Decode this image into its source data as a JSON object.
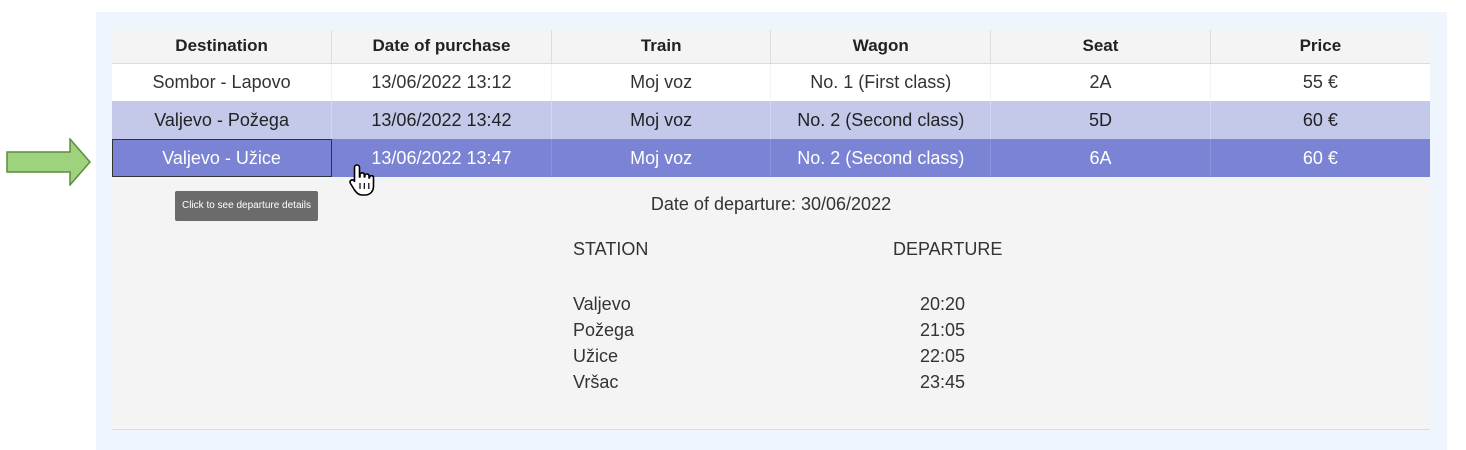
{
  "table": {
    "columns": [
      "Destination",
      "Date of purchase",
      "Train",
      "Wagon",
      "Seat",
      "Price"
    ],
    "rows": [
      [
        "Sombor - Lapovo",
        "13/06/2022 13:12",
        "Moj voz",
        "No. 1 (First class)",
        "2A",
        "55 €"
      ],
      [
        "Valjevo - Požega",
        "13/06/2022 13:42",
        "Moj voz",
        "No. 2 (Second class)",
        "5D",
        "60 €"
      ],
      [
        "Valjevo - Užice",
        "13/06/2022 13:47",
        "Moj voz",
        "No. 2 (Second class)",
        "6A",
        "60 €"
      ]
    ],
    "selected_row": 2
  },
  "tooltip": "Click to see departure details",
  "details": {
    "departure_date": "Date of departure: 30/06/2022",
    "station_header": "STATION",
    "departure_header": "DEPARTURE",
    "stops": [
      {
        "station": "Valjevo",
        "departure": "20:20"
      },
      {
        "station": "Požega",
        "departure": "21:05"
      },
      {
        "station": "Užice",
        "departure": "22:05"
      },
      {
        "station": "Vršac",
        "departure": "23:45"
      }
    ]
  },
  "colors": {
    "row_light": "#c4c8e9",
    "row_selected": "#7a83d4",
    "panel_bg": "#eef5fc",
    "arrow_fill": "#9fd27d",
    "arrow_stroke": "#5c8c3f"
  },
  "icons": {
    "indicator": "right-arrow-icon",
    "cursor": "hand-pointer-icon"
  }
}
